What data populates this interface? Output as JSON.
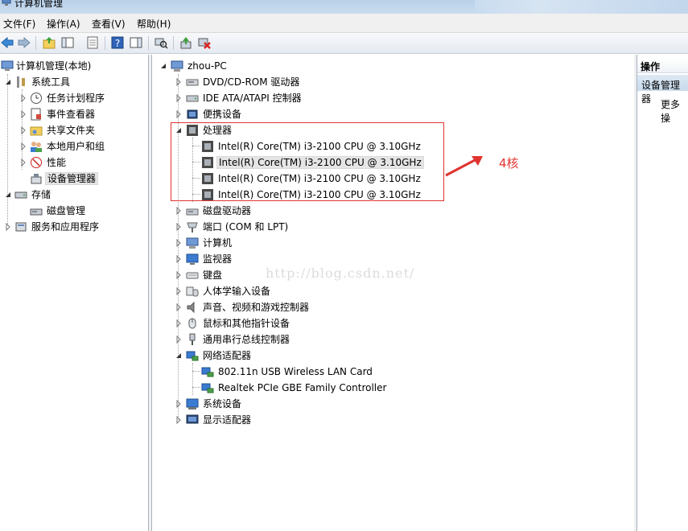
{
  "window": {
    "title": "计算机管理"
  },
  "menubar": {
    "items": [
      "文件(F)",
      "操作(A)",
      "查看(V)",
      "帮助(H)"
    ]
  },
  "left_tree": {
    "root": "计算机管理(本地)",
    "system_tools": "系统工具",
    "task_scheduler": "任务计划程序",
    "event_viewer": "事件查看器",
    "shared_folders": "共享文件夹",
    "local_users": "本地用户和组",
    "performance": "性能",
    "device_manager": "设备管理器",
    "storage": "存储",
    "disk_management": "磁盘管理",
    "services": "服务和应用程序"
  },
  "device_tree": {
    "computer": "zhou-PC",
    "dvd": "DVD/CD-ROM 驱动器",
    "ide": "IDE ATA/ATAPI 控制器",
    "portable": "便携设备",
    "processors": "处理器",
    "cpus": [
      "Intel(R) Core(TM) i3-2100 CPU @ 3.10GHz",
      "Intel(R) Core(TM) i3-2100 CPU @ 3.10GHz",
      "Intel(R) Core(TM) i3-2100 CPU @ 3.10GHz",
      "Intel(R) Core(TM) i3-2100 CPU @ 3.10GHz"
    ],
    "disk_drives": "磁盘驱动器",
    "ports": "端口 (COM 和 LPT)",
    "computer_node": "计算机",
    "monitors": "监视器",
    "keyboards": "键盘",
    "hid": "人体学输入设备",
    "sound": "声音、视频和游戏控制器",
    "mice": "鼠标和其他指针设备",
    "usb": "通用串行总线控制器",
    "network": "网络适配器",
    "nics": [
      "802.11n USB Wireless LAN Card",
      "Realtek PCIe GBE Family Controller"
    ],
    "system_devices": "系统设备",
    "display": "显示适配器"
  },
  "actions_pane": {
    "header": "操作",
    "section": "设备管理器",
    "more": "更多操"
  },
  "annotation": {
    "text": "4核",
    "color": "#e0342f"
  },
  "watermark": "http://blog.csdn.net/"
}
